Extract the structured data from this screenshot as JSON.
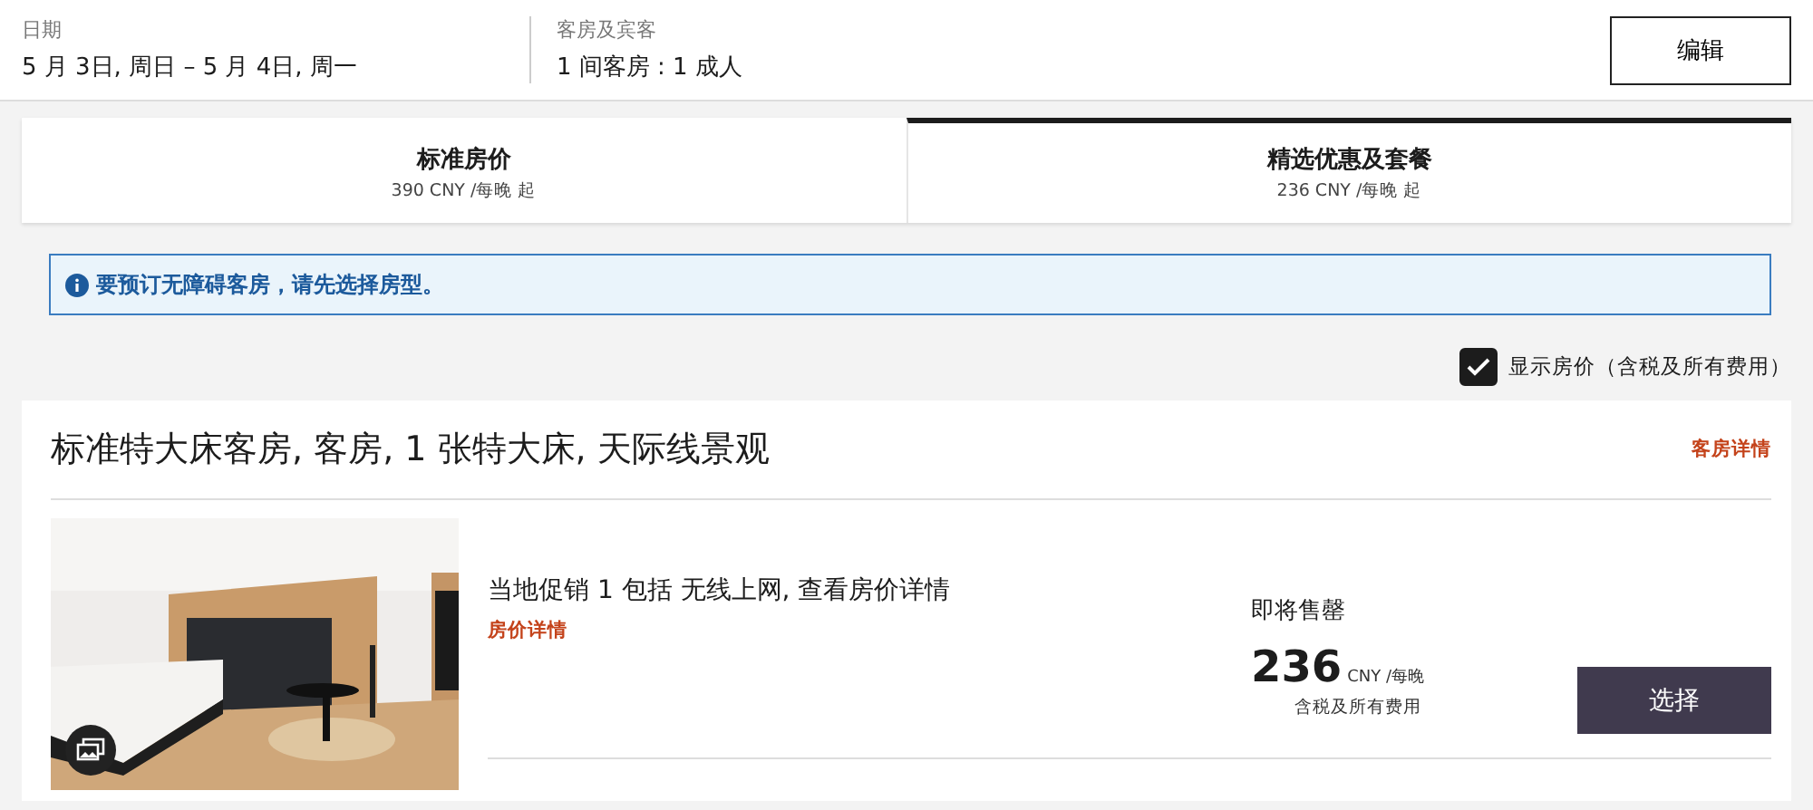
{
  "header": {
    "dates_label": "日期",
    "dates": "5 月 3日, 周日 – 5 月 4日, 周一",
    "guests_label": "客房及宾客",
    "guests": "1 间客房 : 1 成人",
    "edit_button": "编辑"
  },
  "tabs": [
    {
      "title": "标准房价",
      "subtitle": "390 CNY /每晚 起",
      "selected": false
    },
    {
      "title": "精选优惠及套餐",
      "subtitle": "236 CNY /每晚 起",
      "selected": true
    }
  ],
  "alert": {
    "text": "要预订无障碍客房，请先选择房型。"
  },
  "show_price": {
    "label": "显示房价（含税及所有费用）",
    "checked": true
  },
  "room": {
    "title": "标准特大床客房, 客房, 1 张特大床, 天际线景观",
    "details_link": "客房详情",
    "rates": [
      {
        "name": "当地促销 1 包括 无线上网, 查看房价详情",
        "details_link": "房价详情",
        "availability": "即将售罄",
        "price": "236",
        "unit": "CNY /每晚",
        "note": "含税及所有费用",
        "button": "选择"
      }
    ]
  }
}
